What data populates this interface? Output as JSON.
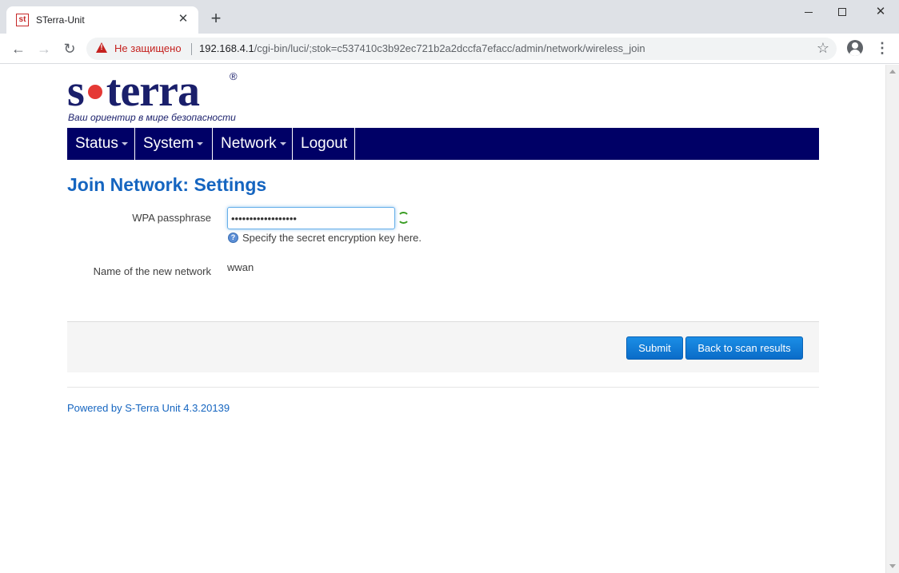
{
  "browser": {
    "tab_title": "STerra-Unit",
    "favicon_text": "st",
    "security_label": "Не защищено",
    "url_host": "192.168.4.1",
    "url_path": "/cgi-bin/luci/;stok=c537410c3b92ec721b2a2dccfa7efacc/admin/network/wireless_join"
  },
  "logo": {
    "left": "s",
    "right": "terra",
    "registered": "®",
    "tagline": "Ваш ориентир в мире безопасности",
    "dot_color": "#e53935"
  },
  "nav": {
    "status": "Status",
    "system": "System",
    "network": "Network",
    "logout": "Logout"
  },
  "page": {
    "title": "Join Network: Settings"
  },
  "form": {
    "wpa_label": "WPA passphrase",
    "wpa_value": "••••••••••••••••••",
    "wpa_help": "Specify the secret encryption key here.",
    "name_label": "Name of the new network",
    "name_value": "wwan"
  },
  "actions": {
    "submit": "Submit",
    "back": "Back to scan results"
  },
  "footer": {
    "powered_by": "Powered by S-Terra Unit 4.3.20139"
  },
  "colors": {
    "nav_bg": "#000066",
    "title": "#1565c0",
    "button": "#0a6cc8"
  },
  "icons": {
    "reveal": "refresh-icon",
    "help": "help-icon",
    "bookmark": "star-icon"
  }
}
